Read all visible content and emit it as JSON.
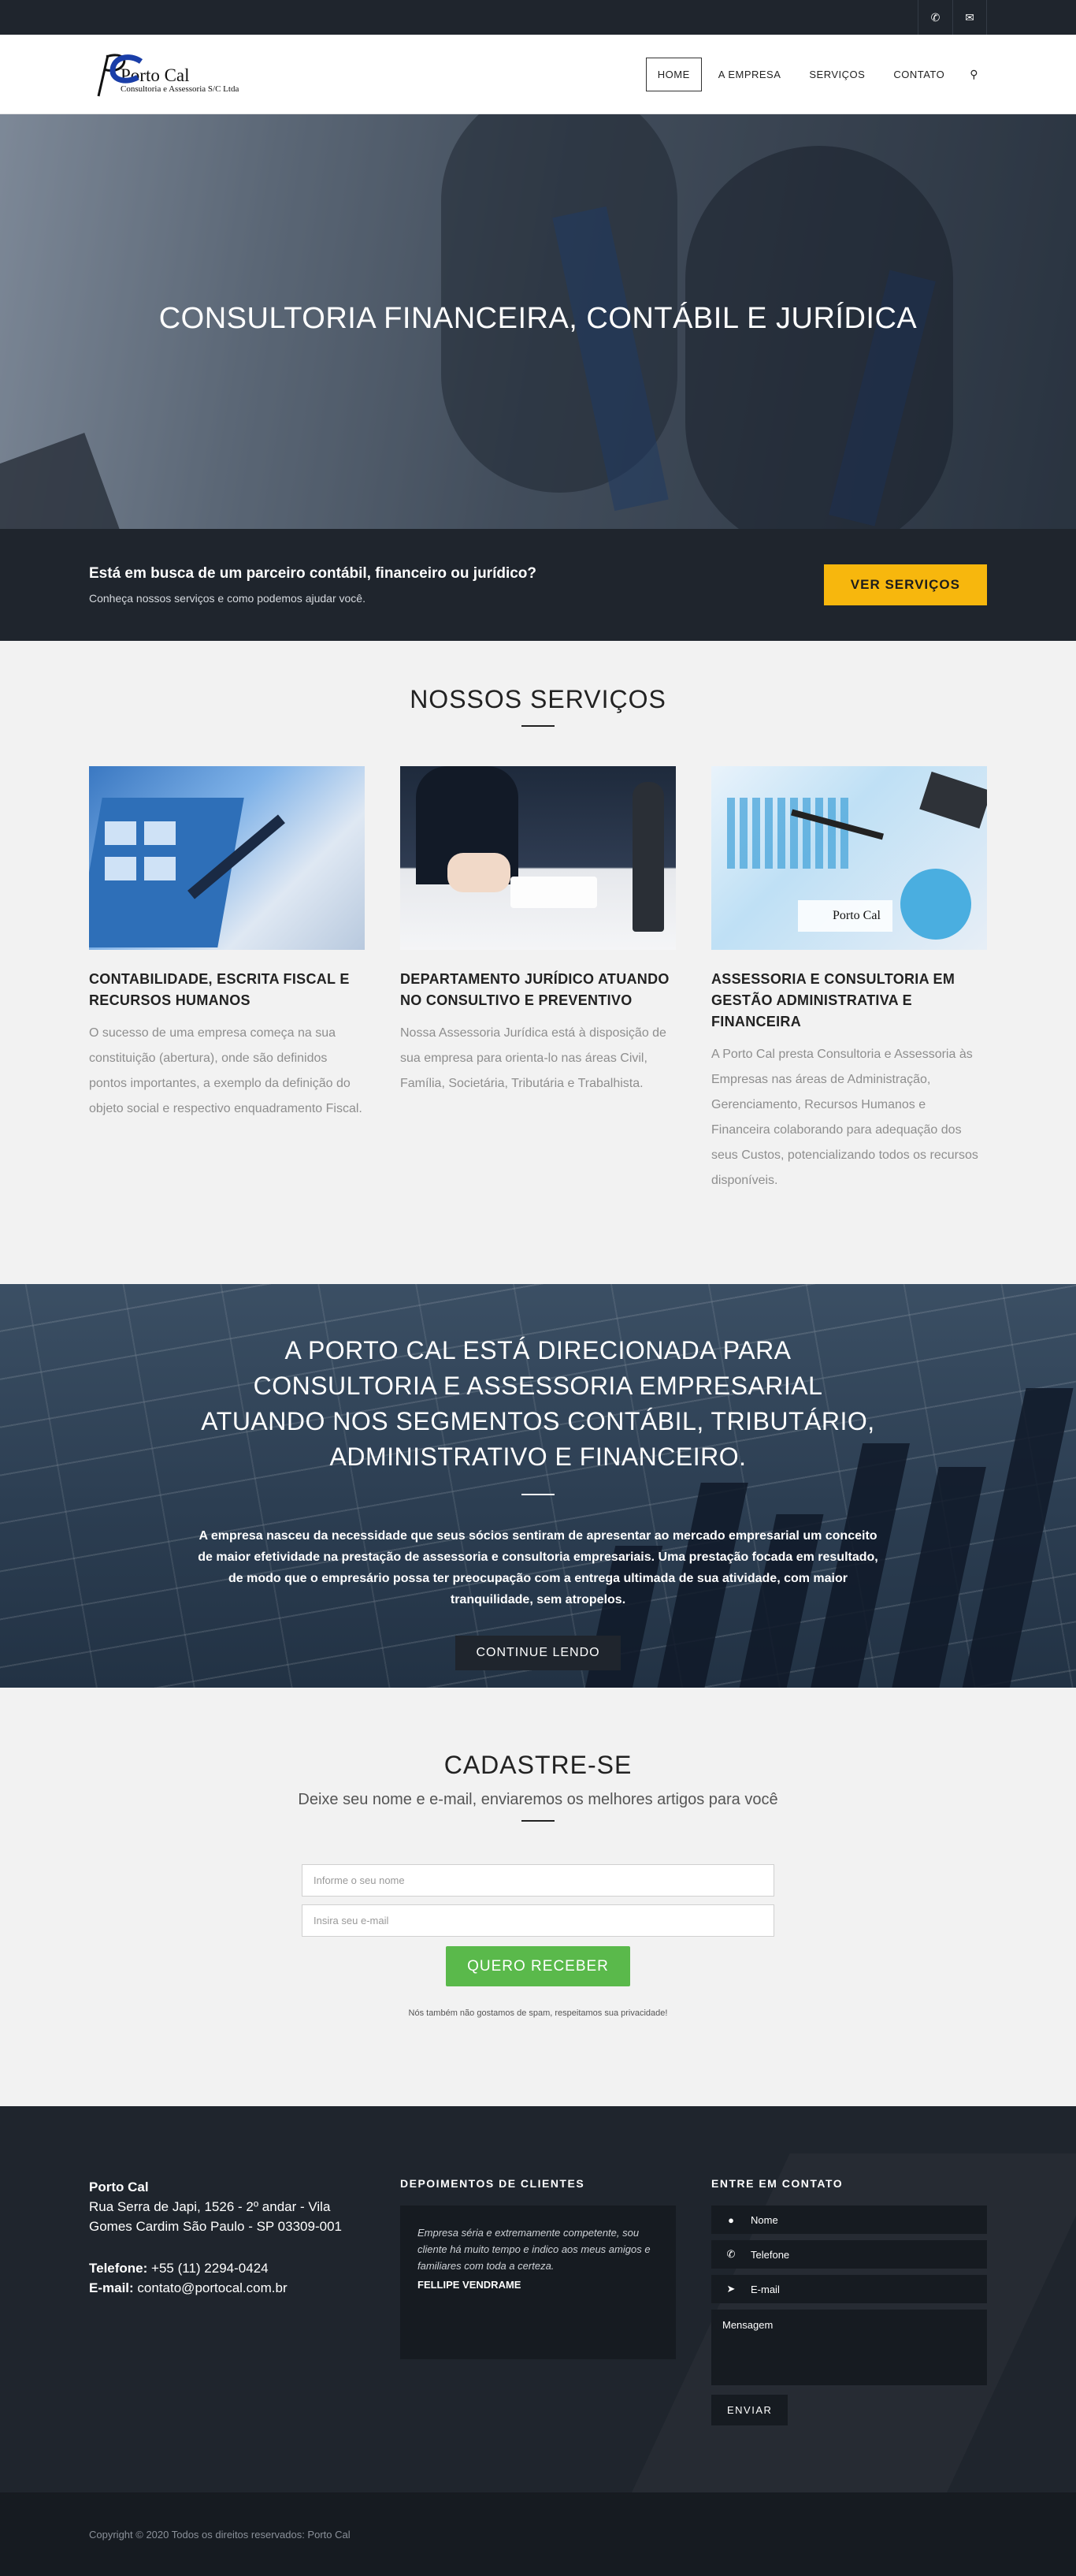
{
  "topbar": {
    "phone_icon": "phone-icon",
    "mail_icon": "mail-icon"
  },
  "header": {
    "logo_name": "Porto Cal",
    "logo_sub": "Consultoria e Assessoria S/C Ltda",
    "nav": [
      {
        "label": "HOME",
        "active": true
      },
      {
        "label": "A EMPRESA"
      },
      {
        "label": "SERVIÇOS"
      },
      {
        "label": "CONTATO"
      }
    ],
    "search_icon": "search-icon"
  },
  "hero": {
    "title": "CONSULTORIA FINANCEIRA, CONTÁBIL E JURÍDICA"
  },
  "cta": {
    "title": "Está em busca de um parceiro contábil, financeiro ou jurídico?",
    "text": "Conheça nossos serviços e como podemos ajudar você.",
    "button": "VER SERVIÇOS"
  },
  "services": {
    "title": "NOSSOS SERVIÇOS",
    "items": [
      {
        "title": "CONTABILIDADE, ESCRITA FISCAL E RECURSOS HUMANOS",
        "text": "O sucesso de uma empresa começa na sua constituição (abertura), onde são definidos pontos importantes, a exemplo da definição do objeto social e respectivo enquadramento Fiscal."
      },
      {
        "title": "DEPARTAMENTO JURÍDICO ATUANDO NO CONSULTIVO E PREVENTIVO",
        "text": "Nossa Assessoria Jurídica está à disposição de sua empresa para orienta-lo nas áreas Civil, Família, Societária, Tributária e Trabalhista."
      },
      {
        "title": "ASSESSORIA E CONSULTORIA EM GESTÃO ADMINISTRATIVA E FINANCEIRA",
        "text": "A Porto Cal presta Consultoria e Assessoria às Empresas nas áreas de Administração, Gerenciamento, Recursos Humanos e Financeira colaborando para adequação dos seus Custos, potencializando todos os recursos disponíveis.",
        "img_label": "Porto Cal"
      }
    ]
  },
  "about": {
    "title": "A PORTO CAL ESTÁ DIRECIONADA PARA CONSULTORIA E ASSESSORIA EMPRESARIAL ATUANDO NOS SEGMENTOS CONTÁBIL, TRIBUTÁRIO, ADMINISTRATIVO E FINANCEIRO.",
    "text": "A empresa nasceu da necessidade que seus sócios sentiram de apresentar ao mercado empresarial um conceito de maior efetividade na prestação de assessoria e consultoria empresariais. Uma prestação focada em resultado, de modo que o empresário possa ter preocupação com a entrega ultimada de sua atividade, com maior tranquilidade, sem atropelos.",
    "button": "CONTINUE LENDO"
  },
  "newsletter": {
    "title": "CADASTRE-SE",
    "subtitle": "Deixe seu nome e e-mail, enviaremos os melhores artigos para você",
    "name_placeholder": "Informe o seu nome",
    "email_placeholder": "Insira seu e-mail",
    "button": "QUERO RECEBER",
    "note": "Nós também não gostamos de spam, respeitamos sua privacidade!"
  },
  "footer": {
    "company": "Porto Cal",
    "address": "Rua Serra de Japi, 1526 - 2º andar - Vila Gomes Cardim São Paulo - SP 03309-001",
    "phone_label": "Telefone:",
    "phone": "+55 (11) 2294-0424",
    "email_label": "E-mail:",
    "email": "contato@portocal.com.br",
    "testimonials_title": "DEPOIMENTOS DE CLIENTES",
    "testimonial_text": "Empresa séria e extremamente competente, sou cliente há muito tempo e indico aos meus amigos e familiares com toda a certeza.",
    "testimonial_author": "FELLIPE VENDRAME",
    "contact_title": "ENTRE EM CONTATO",
    "field_name": "Nome",
    "field_phone": "Telefone",
    "field_email": "E-mail",
    "field_message": "Mensagem",
    "send": "ENVIAR"
  },
  "copyright": "Copyright © 2020 Todos os direitos reservados: Porto Cal"
}
